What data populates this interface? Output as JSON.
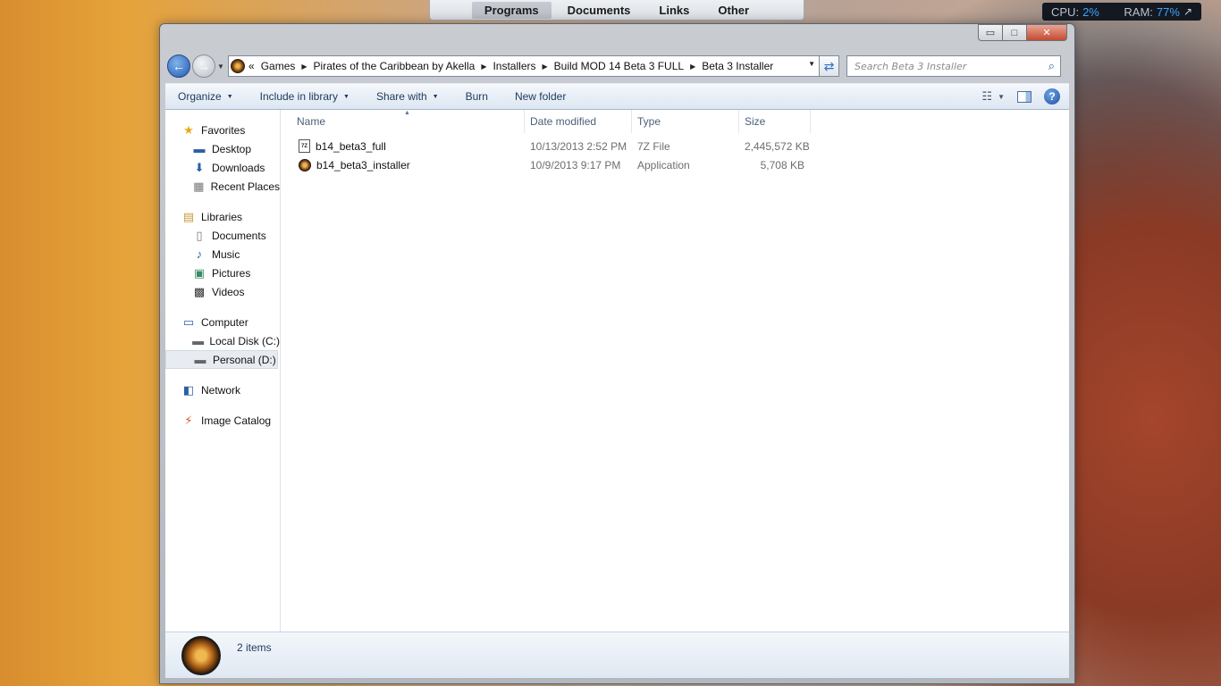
{
  "dock": {
    "tabs": [
      {
        "label": "Programs",
        "active": true
      },
      {
        "label": "Documents",
        "active": false
      },
      {
        "label": "Links",
        "active": false
      },
      {
        "label": "Other",
        "active": false
      }
    ]
  },
  "meter": {
    "cpu_label": "CPU:",
    "cpu_value": "2%",
    "ram_label": "RAM:",
    "ram_value": "77%",
    "arrow": "↗"
  },
  "window": {
    "caption": {
      "minimize": "▭",
      "maximize": "□",
      "close": "✕"
    }
  },
  "address": {
    "lead": "«",
    "crumbs": [
      "Games",
      "Pirates of the Caribbean by Akella",
      "Installers",
      "Build MOD 14 Beta 3 FULL",
      "Beta 3 Installer"
    ]
  },
  "search": {
    "placeholder": "Search Beta 3 Installer"
  },
  "toolbar": {
    "organize": "Organize",
    "include": "Include in library",
    "share": "Share with",
    "burn": "Burn",
    "new_folder": "New folder"
  },
  "navpane": {
    "favorites": {
      "label": "Favorites",
      "items": [
        "Desktop",
        "Downloads",
        "Recent Places"
      ]
    },
    "libraries": {
      "label": "Libraries",
      "items": [
        "Documents",
        "Music",
        "Pictures",
        "Videos"
      ]
    },
    "computer": {
      "label": "Computer",
      "items": [
        "Local Disk (C:)",
        "Personal (D:)"
      ]
    },
    "network": {
      "label": "Network"
    },
    "catalog": {
      "label": "Image Catalog"
    }
  },
  "columns": {
    "name": "Name",
    "date": "Date modified",
    "type": "Type",
    "size": "Size"
  },
  "files": [
    {
      "name": "b14_beta3_full",
      "date": "10/13/2013 2:52 PM",
      "type": "7Z File",
      "size": "2,445,572 KB"
    },
    {
      "name": "b14_beta3_installer",
      "date": "10/9/2013 9:17 PM",
      "type": "Application",
      "size": "5,708 KB"
    }
  ],
  "status": {
    "count": "2 items"
  },
  "colors": {
    "accent": "#1e395b",
    "meter_value": "#3aa6ff"
  }
}
